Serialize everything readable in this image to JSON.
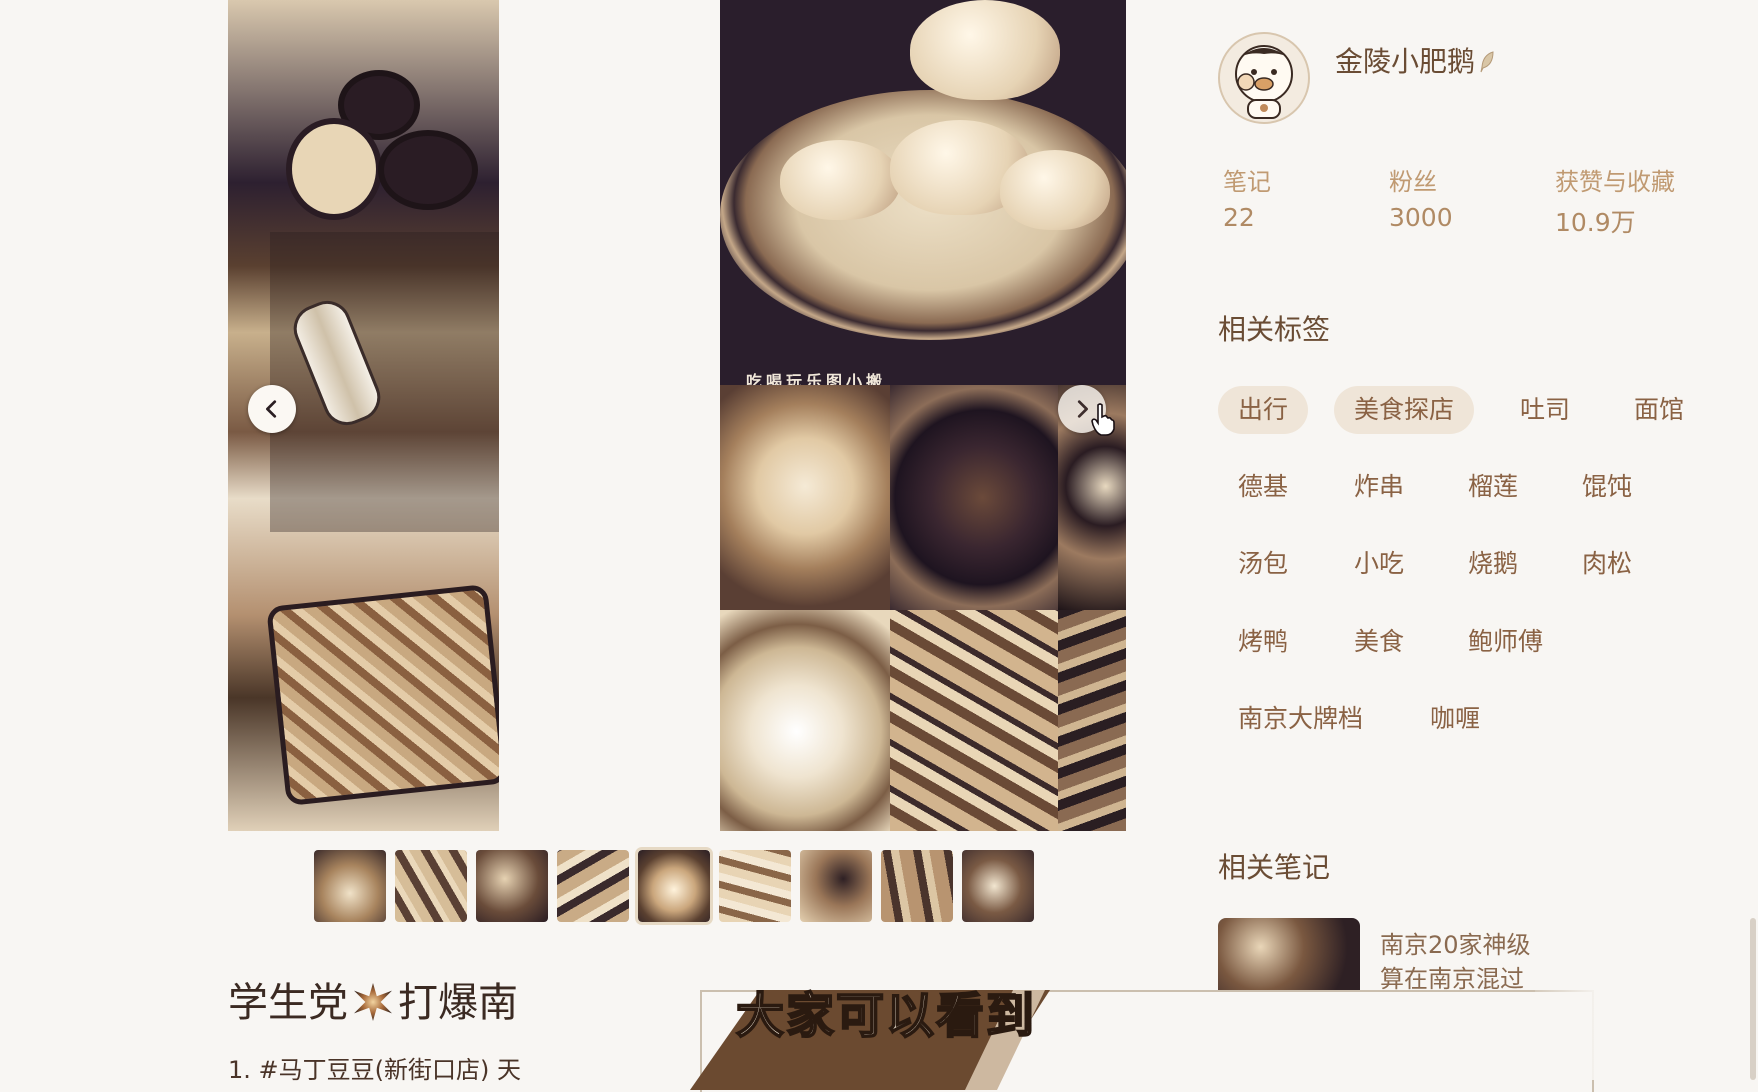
{
  "gallery": {
    "photo_caption": "吃喝玩乐图小搬",
    "thumbnail_count": 9,
    "active_thumbnail": 5
  },
  "note": {
    "title_part1": "学生党",
    "title_part2": "打爆南",
    "body_line1": "1. #马丁豆豆(新街口店) 天"
  },
  "subtitle": "大家可以看到",
  "author": {
    "name": "金陵小肥鹅"
  },
  "stats": {
    "notes_label": "笔记",
    "notes_value": "22",
    "fans_label": "粉丝",
    "fans_value": "3000",
    "likes_label": "获赞与收藏",
    "likes_value": "10.9万"
  },
  "tags": {
    "title": "相关标签",
    "items": [
      "出行",
      "美食探店",
      "吐司",
      "面馆",
      "德基",
      "炸串",
      "榴莲",
      "馄饨",
      "汤包",
      "小吃",
      "烧鹅",
      "肉松",
      "烤鸭",
      "美食",
      "鲍师傅",
      "南京大牌档",
      "咖喱"
    ],
    "selected": [
      "出行",
      "美食探店"
    ]
  },
  "related": {
    "title": "相关笔记",
    "line1": "南京20家神级",
    "line2": "算在南京混过"
  },
  "colors": {
    "accent": "#6a4c34",
    "tag_bg": "#efe5d8"
  }
}
